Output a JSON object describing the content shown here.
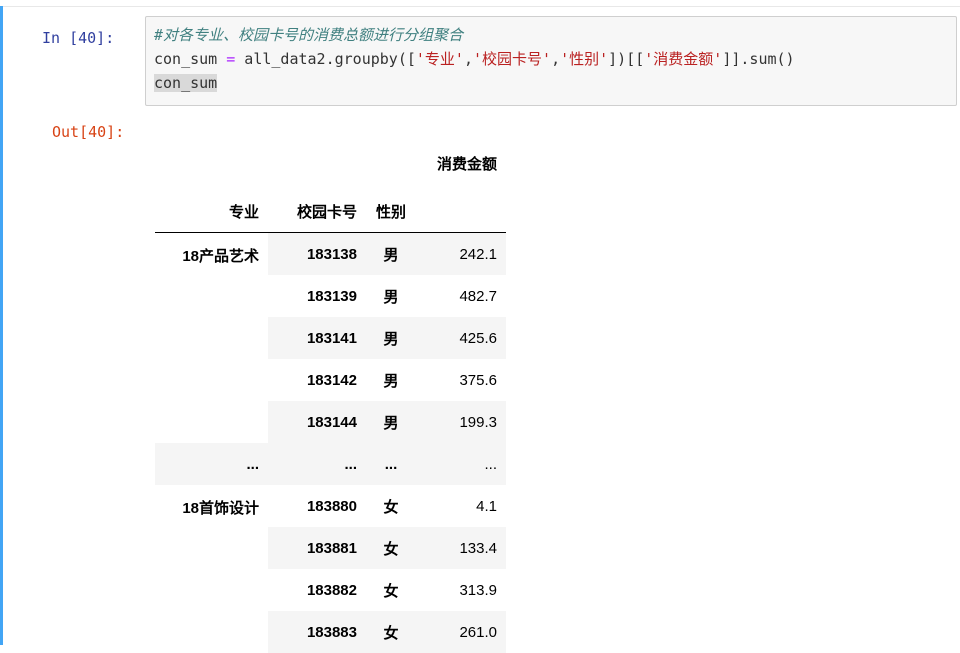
{
  "cell": {
    "in_prompt": "In  [40]:",
    "out_prompt": "Out[40]:",
    "code": {
      "line1_comment": "#对各专业、校园卡号的消费总额进行分组聚合",
      "line2_a": "con_sum ",
      "line2_eq": "=",
      "line2_b": " all_data2.groupby([",
      "line2_s1": "'专业'",
      "line2_c1": ",",
      "line2_s2": "'校园卡号'",
      "line2_c2": ",",
      "line2_s3": "'性别'",
      "line2_c": "])[[",
      "line2_s4": "'消费金额'",
      "line2_d": "]].sum()",
      "line3": "con_sum"
    }
  },
  "dataframe": {
    "value_column": "消费金额",
    "index_names": [
      "专业",
      "校园卡号",
      "性别"
    ],
    "groups": [
      {
        "major": "18产品艺术",
        "rows": [
          {
            "card": "183138",
            "sex": "男",
            "value": "242.1"
          },
          {
            "card": "183139",
            "sex": "男",
            "value": "482.7"
          },
          {
            "card": "183141",
            "sex": "男",
            "value": "425.6"
          },
          {
            "card": "183142",
            "sex": "男",
            "value": "375.6"
          },
          {
            "card": "183144",
            "sex": "男",
            "value": "199.3"
          }
        ]
      },
      {
        "major": "18首饰设计",
        "rows": [
          {
            "card": "183880",
            "sex": "女",
            "value": "4.1"
          },
          {
            "card": "183881",
            "sex": "女",
            "value": "133.4"
          },
          {
            "card": "183882",
            "sex": "女",
            "value": "313.9"
          },
          {
            "card": "183883",
            "sex": "女",
            "value": "261.0"
          }
        ]
      }
    ],
    "ellipsis": "..."
  }
}
